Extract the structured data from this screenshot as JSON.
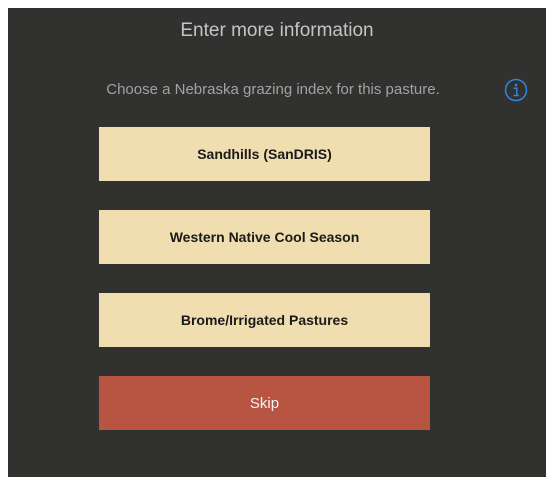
{
  "dialog": {
    "title": "Enter more information",
    "prompt": "Choose a Nebraska grazing index for this pasture.",
    "info_icon": "info-circle-icon",
    "options": [
      {
        "label": "Sandhills (SanDRIS)"
      },
      {
        "label": "Western Native Cool Season"
      },
      {
        "label": "Brome/Irrigated Pastures"
      }
    ],
    "skip_label": "Skip"
  },
  "colors": {
    "background": "#313130",
    "option_button": "#f0ddb0",
    "skip_button": "#b85442",
    "info_accent": "#2f86e0"
  }
}
